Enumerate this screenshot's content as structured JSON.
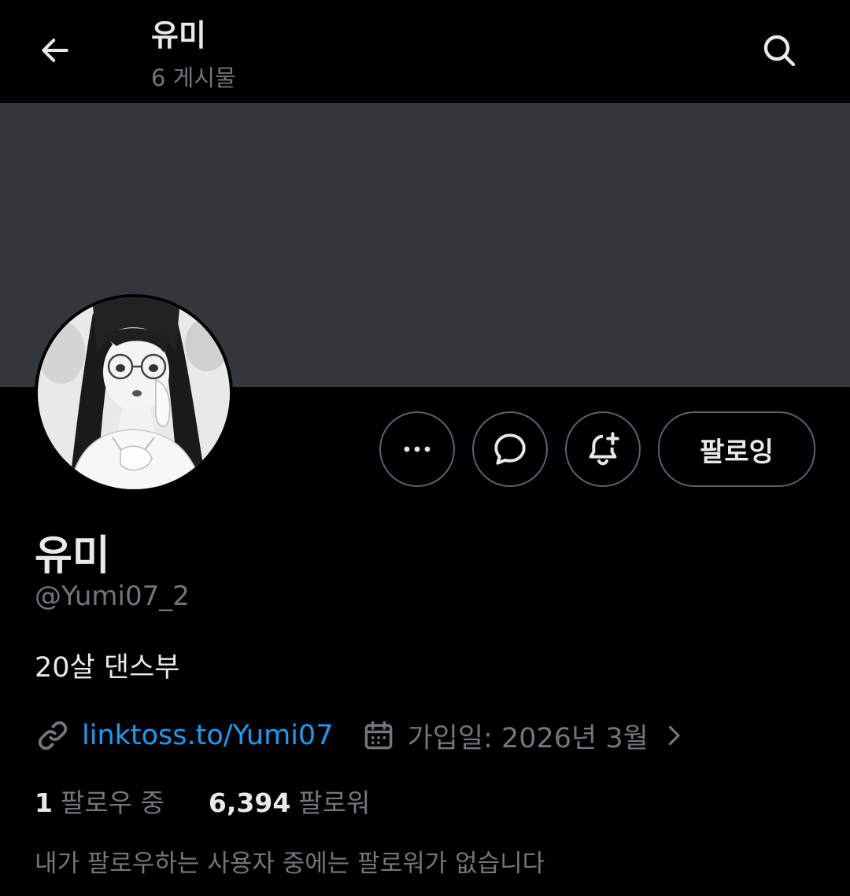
{
  "header": {
    "title": "유미",
    "posts_count": "6 게시물",
    "back_icon": "arrow-left-icon",
    "search_icon": "search-icon"
  },
  "actions": {
    "more_icon": "more-horizontal-icon",
    "message_icon": "message-bubble-icon",
    "notify_icon": "bell-plus-icon",
    "follow_label": "팔로잉"
  },
  "profile": {
    "display_name": "유미",
    "handle": "@Yumi07_2",
    "bio": "20살 댄스부",
    "link_text": "linktoss.to/Yumi07",
    "joined": "가입일: 2026년 3월"
  },
  "stats": {
    "following_count": "1",
    "following_label": "팔로우 중",
    "followers_count": "6,394",
    "followers_label": "팔로워"
  },
  "mutual_note": "내가 팔로우하는 사용자 중에는 팔로워가 없습니다",
  "colors": {
    "background": "#000000",
    "banner": "#33363a",
    "text_primary": "#e7e9ea",
    "text_secondary": "#71767b",
    "link": "#1d9bf0",
    "button_border": "#536471"
  }
}
